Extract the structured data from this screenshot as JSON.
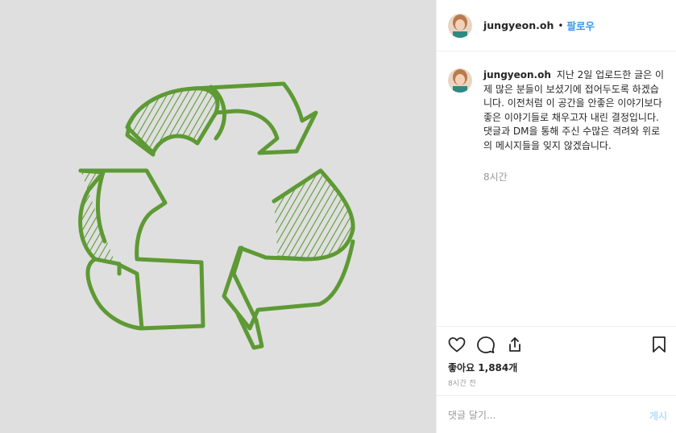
{
  "post_image": {
    "subject": "recycle-symbol-sketch",
    "background_color": "#dfdfdf",
    "stroke_color": "#5e9a34"
  },
  "header": {
    "username": "jungyeon.oh",
    "separator": "•",
    "follow_label": "팔로우"
  },
  "caption": {
    "username": "jungyeon.oh",
    "text": "지난 2일 업로드한 글은 이제 많은 분들이 보셨기에 접어두도록 하겠습니다. 이전처럼 이 공간을 안좋은 이야기보다 좋은 이야기들로 채우고자 내린 결정입니다. 댓글과 DM을 통해 주신 수많은 격려와 위로의 메시지들을 잊지 않겠습니다.",
    "time": "8시간"
  },
  "actions": {
    "icons": [
      "heart-icon",
      "comment-icon",
      "share-icon",
      "bookmark-icon"
    ],
    "likes_text": "좋아요 1,884개",
    "posted_time": "8시간 전"
  },
  "comment_box": {
    "placeholder": "댓글 달기...",
    "post_label": "게시"
  },
  "colors": {
    "accent_blue": "#3897f0",
    "muted_text": "#999999",
    "border": "#efefef"
  }
}
